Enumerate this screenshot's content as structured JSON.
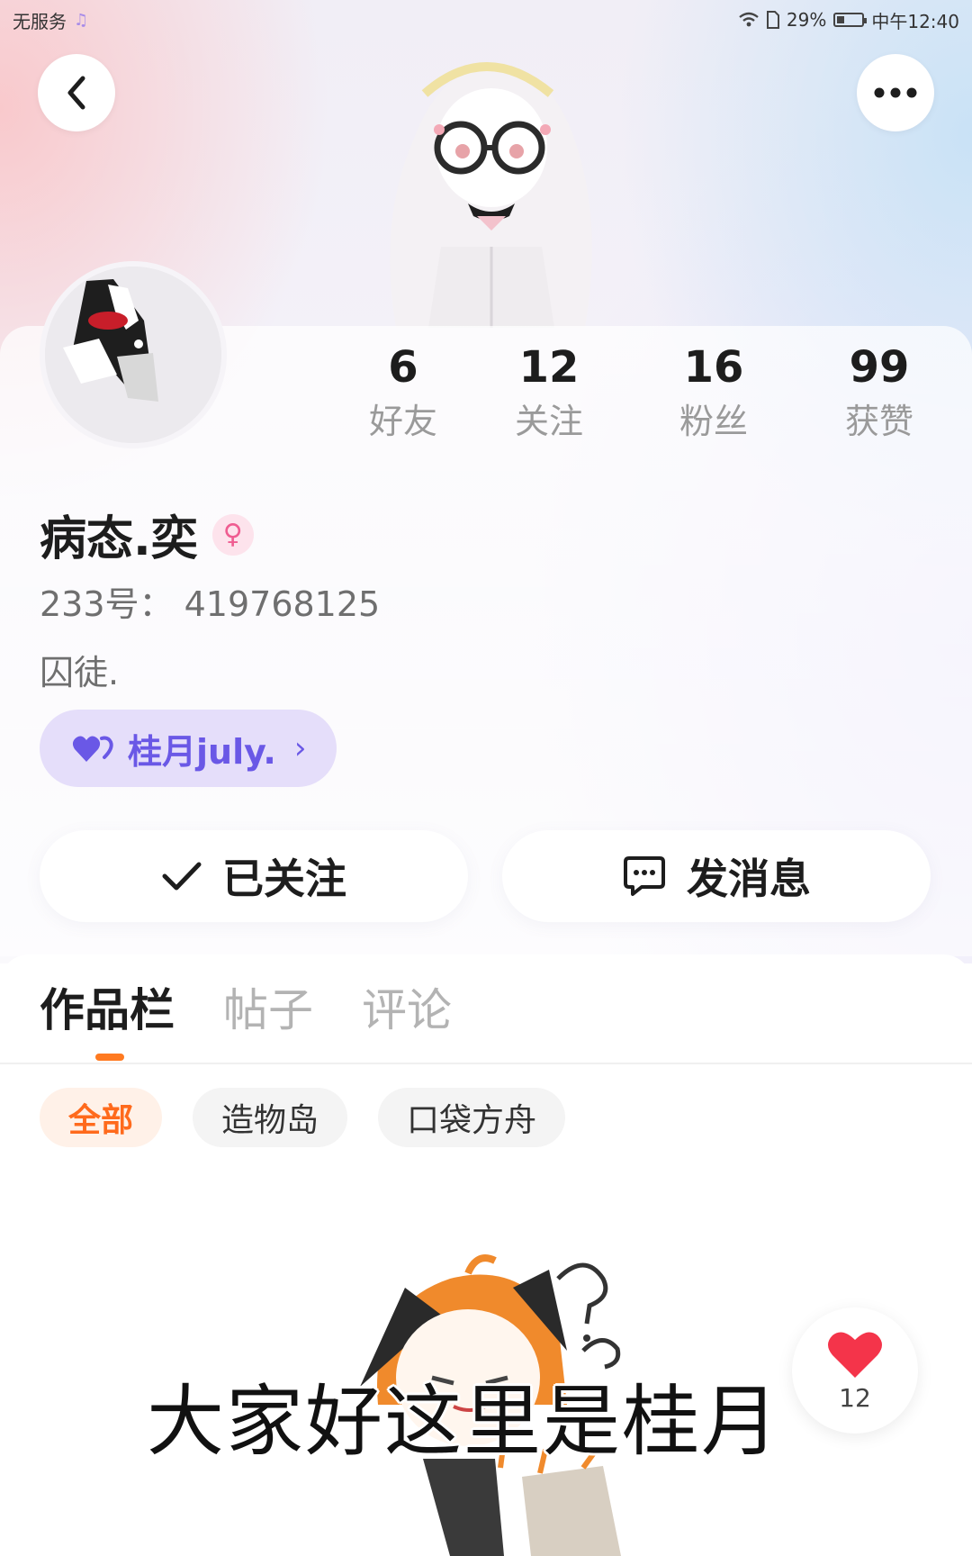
{
  "status_bar": {
    "carrier": "无服务",
    "battery_percent": "29%",
    "battery_level": 0.29,
    "time": "中午12:40"
  },
  "header": {
    "back_icon": "chevron-left-icon",
    "more_icon": "more-dots-icon"
  },
  "stats": [
    {
      "value": "6",
      "label": "好友"
    },
    {
      "value": "12",
      "label": "关注"
    },
    {
      "value": "16",
      "label": "粉丝"
    },
    {
      "value": "99",
      "label": "获赞"
    }
  ],
  "profile": {
    "username": "病态.奕",
    "gender_icon": "female-icon",
    "uid": "233号： 419768125",
    "bio": "囚徒."
  },
  "partner": {
    "name": "桂月july.",
    "icon": "double-heart-icon",
    "chevron": "›"
  },
  "actions": {
    "follow_label": "已关注",
    "message_label": "发消息"
  },
  "tabs": [
    "作品栏",
    "帖子",
    "评论"
  ],
  "chips": [
    "全部",
    "造物岛",
    "口袋方舟"
  ],
  "video": {
    "subtitle": "大家好这里是桂月",
    "like_count": "12"
  },
  "colors": {
    "accent_orange": "#ff7a21",
    "partner_purple": "#6a58e6",
    "like_red": "#f4344a"
  }
}
